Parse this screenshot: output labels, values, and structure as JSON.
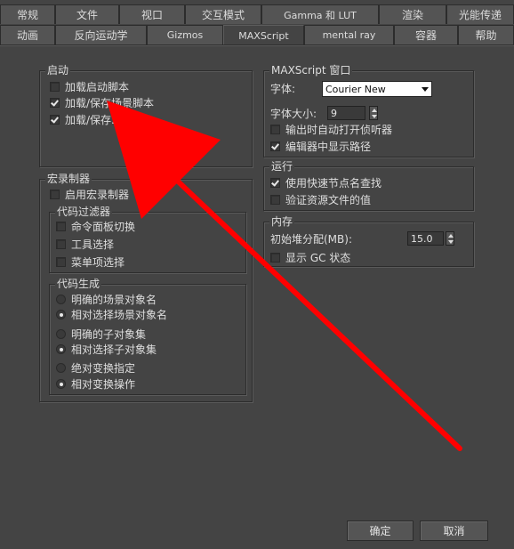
{
  "tabs_row1": [
    "常规",
    "文件",
    "视口",
    "交互模式",
    "Gamma 和 LUT",
    "渲染",
    "光能传递"
  ],
  "tabs_row2": [
    "动画",
    "反向运动学",
    "Gizmos",
    "MAXScript",
    "mental ray",
    "容器",
    "帮助"
  ],
  "active_tab": "MAXScript",
  "startup": {
    "legend": "启动",
    "items": [
      {
        "label": "加载启动脚本",
        "checked": false
      },
      {
        "label": "加载/保存场景脚本",
        "checked": true
      },
      {
        "label": "加载/保存...脚本",
        "checked": true
      }
    ]
  },
  "macro_recorder": {
    "legend": "宏录制器",
    "enable_label": "启用宏录制器",
    "enable_checked": false,
    "code_filter": {
      "legend": "代码过滤器",
      "items": [
        {
          "label": "命令面板切换",
          "checked": false
        },
        {
          "label": "工具选择",
          "checked": false
        },
        {
          "label": "菜单项选择",
          "checked": false
        }
      ]
    },
    "code_generation": {
      "legend": "代码生成",
      "items": [
        {
          "label": "明确的场景对象名",
          "checked": false
        },
        {
          "label": "相对选择场景对象名",
          "checked": true
        },
        {
          "label": "明确的子对象集",
          "checked": false
        },
        {
          "label": "相对选择子对象集",
          "checked": true
        },
        {
          "label": "绝对变换指定",
          "checked": false
        },
        {
          "label": "相对变换操作",
          "checked": true
        }
      ]
    }
  },
  "maxscript_window": {
    "legend": "MAXScript 窗口",
    "font_label": "字体:",
    "font_value": "Courier New",
    "font_size_label": "字体大小:",
    "font_size_value": "9",
    "auto_open_label": "输出时自动打开侦听器",
    "auto_open_checked": false,
    "show_path_label": "编辑器中显示路径",
    "show_path_checked": true
  },
  "run": {
    "legend": "运行",
    "fast_node_label": "使用快速节点名查找",
    "fast_node_checked": true,
    "verify_label": "验证资源文件的值",
    "verify_checked": false
  },
  "memory": {
    "legend": "内存",
    "heap_label": "初始堆分配(MB):",
    "heap_value": "15.0",
    "gc_label": "显示 GC 状态",
    "gc_checked": false
  },
  "buttons": {
    "ok": "确定",
    "cancel": "取消"
  },
  "annotation_color": "#ff0000"
}
